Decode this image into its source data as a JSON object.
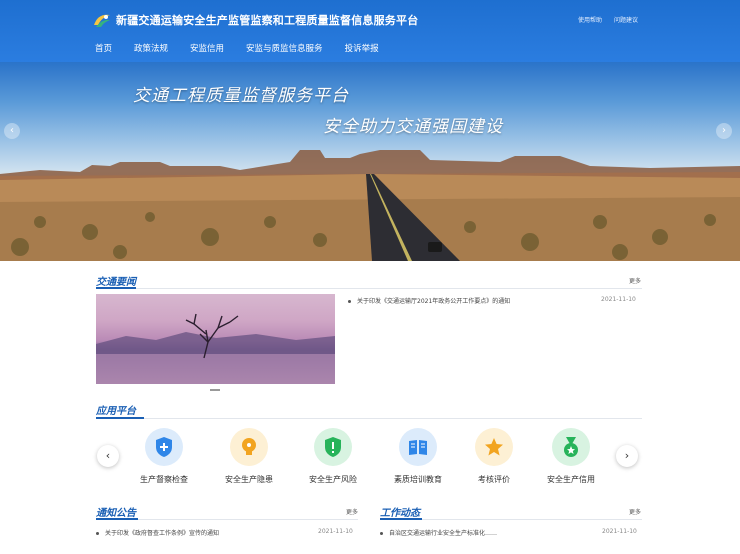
{
  "header": {
    "title": "新疆交通运输安全生产监管监察和工程质量监督信息服务平台",
    "links": [
      "使用帮助",
      "问题建议"
    ],
    "nav": [
      "首页",
      "政策法规",
      "安监信用",
      "安监与质监信息服务",
      "投诉举报"
    ]
  },
  "banner": {
    "slogan1": "交通工程质量监督服务平台",
    "slogan2": "安全助力交通强国建设",
    "prev": "‹",
    "next": "›"
  },
  "news": {
    "title": "交通要闻",
    "more": "更多",
    "items": [
      {
        "text": "关于印发《交通运输厅2021年政务公开工作要点》的通知",
        "date": "2021-11-10"
      }
    ]
  },
  "apps": {
    "title": "应用平台",
    "prev": "‹",
    "next": "›",
    "items": [
      {
        "label": "生产督察检查",
        "icon": "shield-plus-icon",
        "color": "#2f86e8"
      },
      {
        "label": "安全生产隐患",
        "icon": "lightbulb-icon",
        "color": "#f2a41f"
      },
      {
        "label": "安全生产风险",
        "icon": "shield-alert-icon",
        "color": "#27b35a"
      },
      {
        "label": "素质培训教育",
        "icon": "book-icon",
        "color": "#2f86e8"
      },
      {
        "label": "考核评价",
        "icon": "star-icon",
        "color": "#f2a41f"
      },
      {
        "label": "安全生产信用",
        "icon": "medal-icon",
        "color": "#27b35a"
      }
    ]
  },
  "notice": {
    "title": "通知公告",
    "more": "更多",
    "items": [
      {
        "text": "关于印发《政府督查工作条例》宣传的通知",
        "date": "2021-11-10"
      }
    ]
  },
  "work": {
    "title": "工作动态",
    "more": "更多",
    "items": [
      {
        "text": "自治区交通运输行业安全生产标准化……",
        "date": "2021-11-10"
      }
    ]
  }
}
